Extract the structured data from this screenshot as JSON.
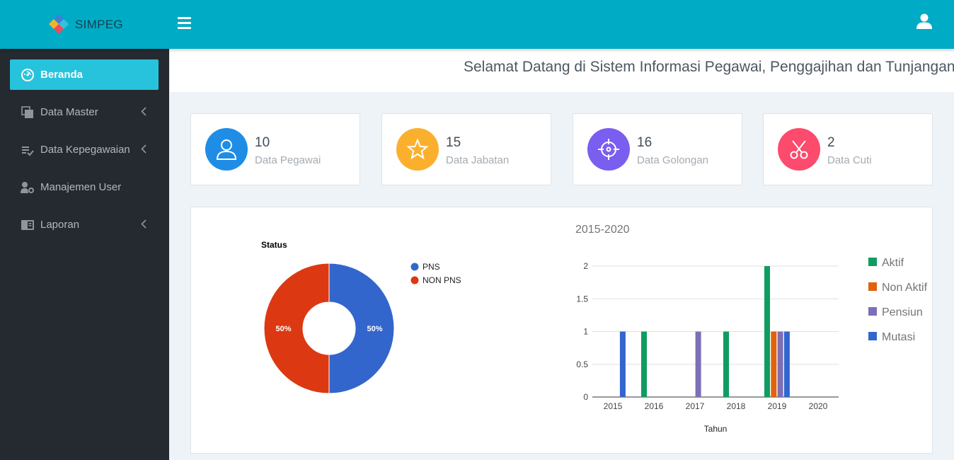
{
  "app": {
    "name": "SIMPEG"
  },
  "welcome": "Selamat Datang di Sistem Informasi Pegawai, Penggajihan dan Tunjangan Pa",
  "sidebar": {
    "items": [
      {
        "label": "Beranda",
        "icon": "dashboard-icon",
        "active": true,
        "chevron": false
      },
      {
        "label": "Data Master",
        "icon": "copy-icon",
        "active": false,
        "chevron": true
      },
      {
        "label": "Data Kepegawaian",
        "icon": "list-check-icon",
        "active": false,
        "chevron": true
      },
      {
        "label": "Manajemen User",
        "icon": "user-cog-icon",
        "active": false,
        "chevron": false
      },
      {
        "label": "Laporan",
        "icon": "book-icon",
        "active": false,
        "chevron": true
      }
    ]
  },
  "cards": [
    {
      "count": "10",
      "label": "Data Pegawai",
      "color": "#1f8de6",
      "icon": "user-icon"
    },
    {
      "count": "15",
      "label": "Data Jabatan",
      "color": "#fbb02d",
      "icon": "star-icon"
    },
    {
      "count": "16",
      "label": "Data Golongan",
      "color": "#7a5ef0",
      "icon": "crosshair-icon"
    },
    {
      "count": "2",
      "label": "Data Cuti",
      "color": "#fc4b6c",
      "icon": "scissors-icon"
    }
  ],
  "chart_data": [
    {
      "type": "pie",
      "title": "Status",
      "categories": [
        "PNS",
        "NON PNS"
      ],
      "values": [
        50,
        50
      ],
      "slice_labels": [
        "50%",
        "50%"
      ],
      "colors": [
        "#3366cc",
        "#dc3912"
      ],
      "donut": true,
      "legend": "right"
    },
    {
      "type": "bar",
      "title": "2015-2020",
      "xlabel": "Tahun",
      "ylabel": "",
      "categories": [
        "2015",
        "2016",
        "2017",
        "2018",
        "2019",
        "2020"
      ],
      "series": [
        {
          "name": "Aktif",
          "color": "#109c61",
          "values": [
            0,
            1,
            0,
            1,
            2,
            0
          ]
        },
        {
          "name": "Non Aktif",
          "color": "#e0620d",
          "values": [
            0,
            0,
            0,
            0,
            1,
            0
          ]
        },
        {
          "name": "Pensiun",
          "color": "#7c6fb8",
          "values": [
            0,
            0,
            1,
            0,
            1,
            0
          ]
        },
        {
          "name": "Mutasi",
          "color": "#3366cc",
          "values": [
            1,
            0,
            0,
            0,
            1,
            0
          ]
        }
      ],
      "yticks": [
        "0",
        "0.5",
        "1",
        "1.5",
        "2"
      ],
      "ylim": [
        0,
        2
      ],
      "grid": true,
      "legend": "right"
    }
  ]
}
